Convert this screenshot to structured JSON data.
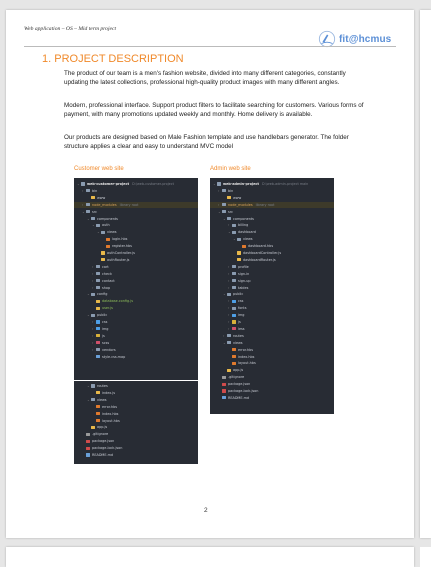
{
  "header": {
    "left_text": "Web application – OS – Mid term project",
    "logo_text": "fit@hcmus"
  },
  "section": {
    "heading": "1. PROJECT DESCRIPTION",
    "paragraphs": [
      "The product of our team is a men's fashion website, divided into many different categories, constantly updating the latest collections, professional high-quality product images with many different angles.",
      "Modern, professional interface. Support product filters to facilitate searching for customers. Various forms of payment, with many promotions updated weekly and monthly. Home delivery is available.",
      "Our products are designed based on Male Fashion template and use handlebars generator. The folder structure applies a clear and easy to understand MVC model"
    ]
  },
  "captions": {
    "customer": "Customer web site",
    "admin": "Admin web site"
  },
  "customer_tree_top": [
    {
      "d": 0,
      "t": "folder",
      "c": "v",
      "l": "web-customer-project",
      "x": "D:\\web-customer-project"
    },
    {
      "d": 1,
      "t": "folder",
      "c": ">",
      "l": "bin"
    },
    {
      "d": 2,
      "t": "file-y",
      "l": "www"
    },
    {
      "d": 1,
      "t": "folder",
      "c": ">",
      "l": "node_modules",
      "x": "library root",
      "hl": true
    },
    {
      "d": 1,
      "t": "folder",
      "c": "v",
      "l": "src"
    },
    {
      "d": 2,
      "t": "folder",
      "c": "v",
      "l": "components"
    },
    {
      "d": 3,
      "t": "folder",
      "c": "v",
      "l": "auth"
    },
    {
      "d": 4,
      "t": "folder",
      "c": "v",
      "l": "views"
    },
    {
      "d": 5,
      "t": "file-o",
      "l": "login.hbs"
    },
    {
      "d": 5,
      "t": "file-o",
      "l": "register.hbs"
    },
    {
      "d": 4,
      "t": "file-y",
      "l": "authController.js"
    },
    {
      "d": 4,
      "t": "file-y",
      "l": "authRouter.js"
    },
    {
      "d": 3,
      "t": "folder",
      "c": ">",
      "l": "cart"
    },
    {
      "d": 3,
      "t": "folder",
      "c": ">",
      "l": "check"
    },
    {
      "d": 3,
      "t": "folder",
      "c": ">",
      "l": "contact"
    },
    {
      "d": 3,
      "t": "folder",
      "c": ">",
      "l": "shop"
    },
    {
      "d": 2,
      "t": "folder",
      "c": "v",
      "l": "config"
    },
    {
      "d": 3,
      "t": "file-y",
      "l": "database.config.js",
      "g": true
    },
    {
      "d": 3,
      "t": "file-y",
      "l": "user.js",
      "g": true
    },
    {
      "d": 2,
      "t": "folder",
      "c": "v",
      "l": "public"
    },
    {
      "d": 3,
      "t": "folder-b",
      "c": ">",
      "l": "css"
    },
    {
      "d": 3,
      "t": "folder-b",
      "c": ">",
      "l": "img"
    },
    {
      "d": 3,
      "t": "folder-y",
      "c": ">",
      "l": "js"
    },
    {
      "d": 3,
      "t": "folder-r",
      "c": ">",
      "l": "scss"
    },
    {
      "d": 3,
      "t": "folder",
      "c": ">",
      "l": "vendors"
    },
    {
      "d": 3,
      "t": "file-b",
      "l": "style.css.map"
    }
  ],
  "customer_tree_bottom": [
    {
      "d": 2,
      "t": "folder",
      "c": "v",
      "l": "routes"
    },
    {
      "d": 3,
      "t": "file-y",
      "l": "index.js"
    },
    {
      "d": 2,
      "t": "folder",
      "c": "v",
      "l": "views"
    },
    {
      "d": 3,
      "t": "file-o",
      "l": "error.hbs"
    },
    {
      "d": 3,
      "t": "file-o",
      "l": "index.hbs"
    },
    {
      "d": 3,
      "t": "file-o",
      "l": "layout.hbs"
    },
    {
      "d": 2,
      "t": "file-y",
      "l": "app.js"
    },
    {
      "d": 1,
      "t": "file-g",
      "l": ".gitignore"
    },
    {
      "d": 1,
      "t": "file-r",
      "l": "package.json"
    },
    {
      "d": 1,
      "t": "file-r",
      "l": "package-lock.json"
    },
    {
      "d": 1,
      "t": "file-b",
      "l": "README.md"
    }
  ],
  "admin_tree": [
    {
      "d": 0,
      "t": "folder",
      "c": "v",
      "l": "web-admin-project",
      "x": "D:\\web-admin-project  main"
    },
    {
      "d": 1,
      "t": "folder",
      "c": ">",
      "l": "bin"
    },
    {
      "d": 2,
      "t": "file-y",
      "l": "www"
    },
    {
      "d": 1,
      "t": "folder",
      "c": ">",
      "l": "node_modules",
      "x": "library root",
      "hl": true
    },
    {
      "d": 1,
      "t": "folder",
      "c": "v",
      "l": "src"
    },
    {
      "d": 2,
      "t": "folder",
      "c": "v",
      "l": "components"
    },
    {
      "d": 3,
      "t": "folder",
      "c": ">",
      "l": "billing"
    },
    {
      "d": 3,
      "t": "folder",
      "c": "v",
      "l": "dashboard"
    },
    {
      "d": 4,
      "t": "folder",
      "c": "v",
      "l": "views"
    },
    {
      "d": 5,
      "t": "file-o",
      "l": "dashboard.hbs"
    },
    {
      "d": 4,
      "t": "file-y",
      "l": "dashboardController.js"
    },
    {
      "d": 4,
      "t": "file-y",
      "l": "dashboardRouter.js"
    },
    {
      "d": 3,
      "t": "folder",
      "c": ">",
      "l": "profile"
    },
    {
      "d": 3,
      "t": "folder",
      "c": ">",
      "l": "sign-in"
    },
    {
      "d": 3,
      "t": "folder",
      "c": ">",
      "l": "sign-up"
    },
    {
      "d": 3,
      "t": "folder",
      "c": ">",
      "l": "tables"
    },
    {
      "d": 2,
      "t": "folder",
      "c": "v",
      "l": "public"
    },
    {
      "d": 3,
      "t": "folder-b",
      "c": ">",
      "l": "css"
    },
    {
      "d": 3,
      "t": "folder",
      "c": ">",
      "l": "fonts"
    },
    {
      "d": 3,
      "t": "folder-b",
      "c": ">",
      "l": "img"
    },
    {
      "d": 3,
      "t": "folder-y",
      "c": ">",
      "l": "js"
    },
    {
      "d": 3,
      "t": "folder-r",
      "c": ">",
      "l": "less"
    },
    {
      "d": 2,
      "t": "folder",
      "c": ">",
      "l": "routes"
    },
    {
      "d": 2,
      "t": "folder",
      "c": "v",
      "l": "views"
    },
    {
      "d": 3,
      "t": "file-o",
      "l": "error.hbs"
    },
    {
      "d": 3,
      "t": "file-o",
      "l": "index.hbs"
    },
    {
      "d": 3,
      "t": "file-o",
      "l": "layout.hbs"
    },
    {
      "d": 2,
      "t": "file-y",
      "l": "app.js"
    },
    {
      "d": 1,
      "t": "file-g",
      "l": ".gitignore"
    },
    {
      "d": 1,
      "t": "file-r",
      "l": "package.json"
    },
    {
      "d": 1,
      "t": "file-r",
      "l": "package-lock.json"
    },
    {
      "d": 1,
      "t": "file-b",
      "l": "README.md"
    }
  ],
  "icon_colors": {
    "folder": "#8a9bb0",
    "folder-b": "#4e9fe6",
    "folder-y": "#d8b13a",
    "folder-r": "#d0506a",
    "file-y": "#e8b84a",
    "file-o": "#e07a2e",
    "file-r": "#d04b4b",
    "file-b": "#6aa0d8",
    "file-g": "#9a9a9a"
  },
  "page_number": "2"
}
